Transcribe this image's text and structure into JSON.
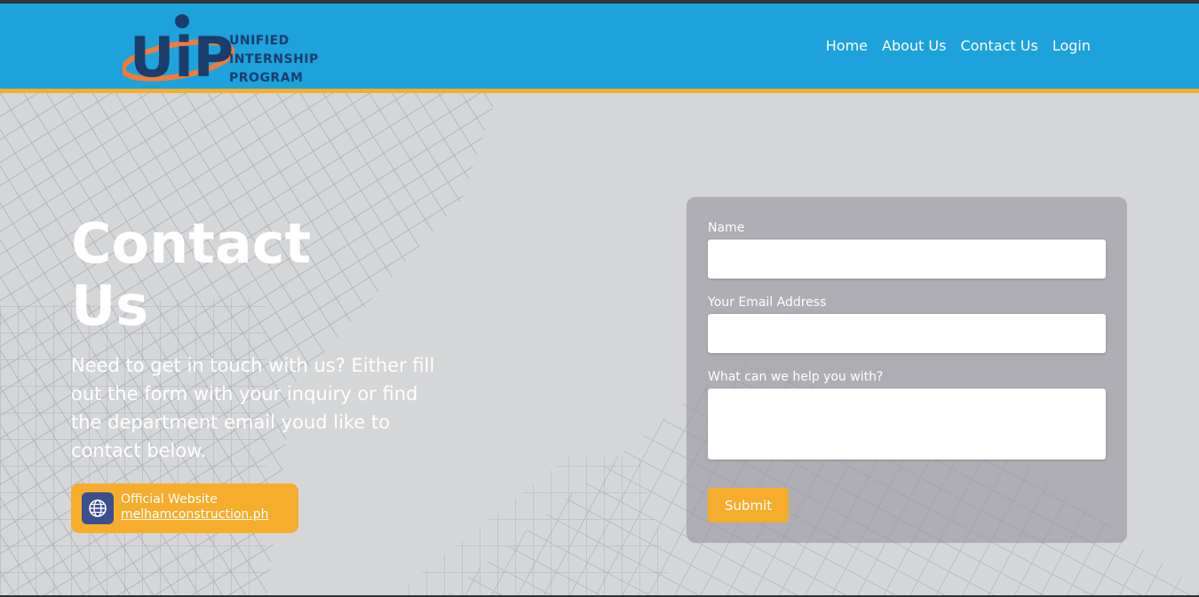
{
  "brand": {
    "logo_lines": [
      "UNIFIED",
      "INTERNSHIP",
      "PROGRAM"
    ],
    "colors": {
      "header": "#1da2dc",
      "accent": "#f6ac2c",
      "logo_dark": "#1a3d6b",
      "logo_orange": "#f07c3a"
    }
  },
  "nav": {
    "home": "Home",
    "about": "About Us",
    "contact": "Contact Us",
    "login": "Login"
  },
  "hero": {
    "title_line1": "Contact",
    "title_line2": "Us",
    "description": "Need to get in touch with us? Either fill out the form with your inquiry or find the department email youd like to contact below."
  },
  "website_card": {
    "icon": "globe-icon",
    "label": "Official Website",
    "link": "melhamconstruction.ph"
  },
  "form": {
    "name_label": "Name",
    "name_value": "",
    "email_label": "Your Email Address",
    "email_value": "",
    "message_label": "What can we help you with?",
    "message_value": "",
    "submit_label": "Submit"
  }
}
